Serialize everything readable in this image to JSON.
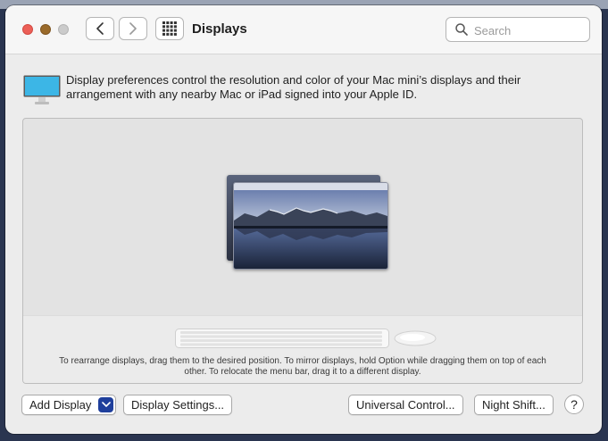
{
  "window": {
    "title": "Displays"
  },
  "search": {
    "placeholder": "Search"
  },
  "description": {
    "text": "Display preferences control the resolution and color of your Mac mini’s displays and their arrangement with any nearby Mac or iPad signed into your Apple ID."
  },
  "arrangement": {
    "hint": "To rearrange displays, drag them to the desired position. To mirror displays, hold Option while dragging them on top of each other. To relocate the menu bar, drag it to a different display."
  },
  "buttons": {
    "add_display": "Add Display",
    "display_settings": "Display Settings...",
    "universal_control": "Universal Control...",
    "night_shift": "Night Shift...",
    "help": "?"
  },
  "colors": {
    "close": "#ec5f57",
    "minimize": "#9a6a2a",
    "zoom": "#cbcbcb",
    "dropdown_accent": "#1f3f9c",
    "display_icon": "#3cb6e6"
  },
  "icons": {
    "back": "chevron-left-icon",
    "forward": "chevron-right-icon",
    "grid": "grid-icon",
    "search": "search-icon",
    "display": "display-icon",
    "dropdown": "chevron-down-icon"
  }
}
